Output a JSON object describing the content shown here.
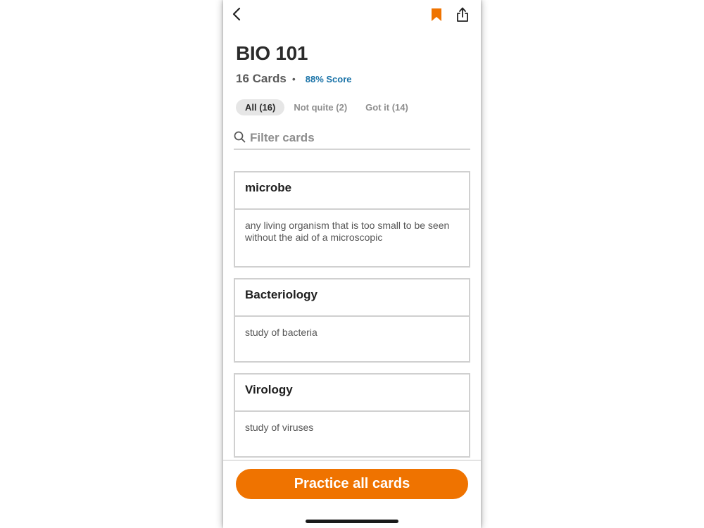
{
  "deck": {
    "title": "BIO 101",
    "card_count": "16 Cards",
    "separator": "•",
    "score": "88% Score"
  },
  "tabs": [
    {
      "label": "All (16)",
      "active": true
    },
    {
      "label": "Not quite (2)",
      "active": false
    },
    {
      "label": "Got it (14)",
      "active": false
    }
  ],
  "search": {
    "placeholder": "Filter cards",
    "value": ""
  },
  "cards": [
    {
      "term": "microbe",
      "definition": "any living organism that is too small to be seen without the aid of a microscopic"
    },
    {
      "term": "Bacteriology",
      "definition": "study of bacteria"
    },
    {
      "term": "Virology",
      "definition": "study of viruses"
    }
  ],
  "practice_button": {
    "label": "Practice all cards"
  },
  "icons": {
    "back": "chevron-left-icon",
    "bookmark": "bookmark-icon",
    "share": "share-icon",
    "search": "search-icon"
  },
  "colors": {
    "accent": "#ef7300",
    "score": "#1a73a8"
  }
}
